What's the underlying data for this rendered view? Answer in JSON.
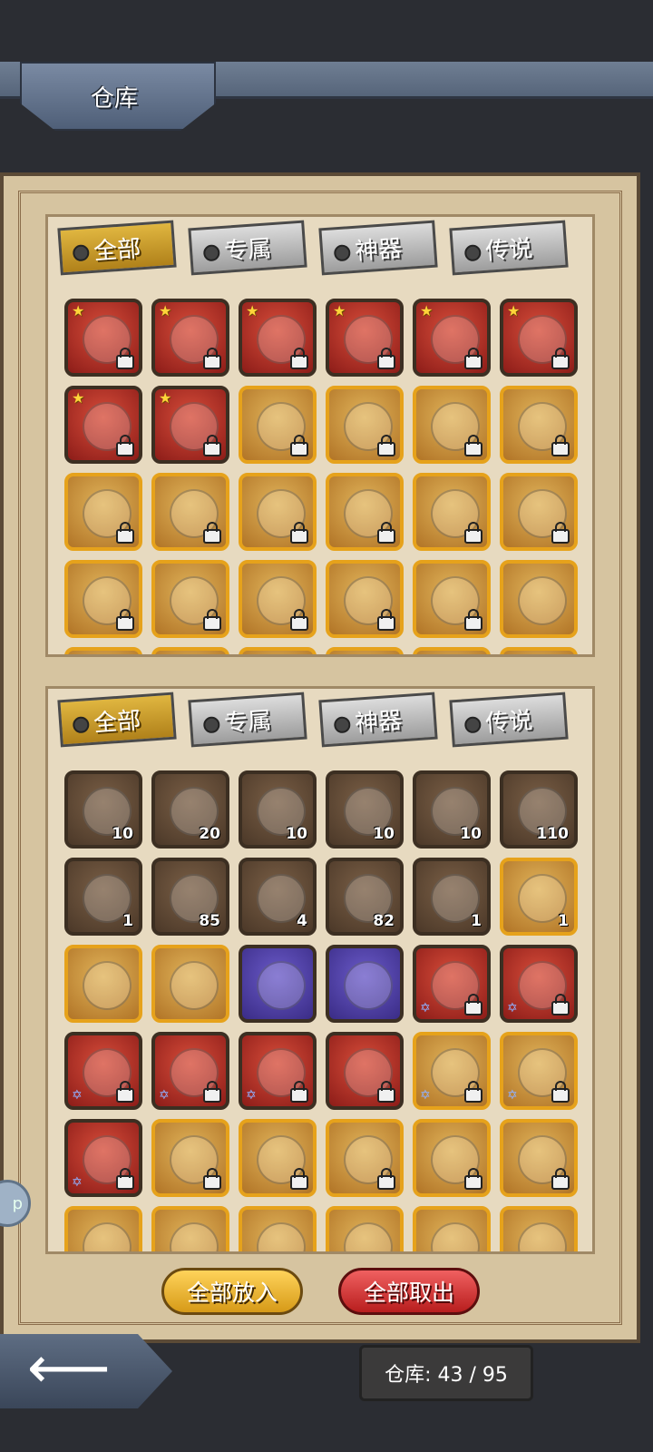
{
  "header": {
    "title": "仓库"
  },
  "top_section": {
    "tabs": [
      {
        "label": "全部",
        "active": true
      },
      {
        "label": "专属",
        "active": false
      },
      {
        "label": "神器",
        "active": false
      },
      {
        "label": "传说",
        "active": false
      }
    ],
    "items": [
      {
        "type": "red",
        "star": true,
        "lock": true
      },
      {
        "type": "red",
        "star": true,
        "lock": true
      },
      {
        "type": "red",
        "star": true,
        "lock": true
      },
      {
        "type": "red",
        "star": true,
        "lock": true
      },
      {
        "type": "red",
        "star": true,
        "lock": true
      },
      {
        "type": "red",
        "star": true,
        "lock": true
      },
      {
        "type": "red",
        "star": true,
        "lock": true
      },
      {
        "type": "red",
        "star": true,
        "lock": true
      },
      {
        "type": "gold",
        "star": false,
        "lock": true
      },
      {
        "type": "gold",
        "star": false,
        "lock": true
      },
      {
        "type": "gold",
        "star": false,
        "lock": true
      },
      {
        "type": "gold",
        "star": false,
        "lock": true
      },
      {
        "type": "gold",
        "star": false,
        "lock": true
      },
      {
        "type": "gold",
        "star": false,
        "lock": true
      },
      {
        "type": "gold",
        "star": false,
        "lock": true
      },
      {
        "type": "gold",
        "star": false,
        "lock": true
      },
      {
        "type": "gold",
        "star": false,
        "lock": true
      },
      {
        "type": "gold",
        "star": false,
        "lock": true
      },
      {
        "type": "gold",
        "star": false,
        "lock": true
      },
      {
        "type": "gold",
        "star": false,
        "lock": true
      },
      {
        "type": "gold",
        "star": false,
        "lock": true
      },
      {
        "type": "gold",
        "star": false,
        "lock": true
      },
      {
        "type": "gold",
        "star": false,
        "lock": true
      },
      {
        "type": "gold",
        "star": false,
        "lock": false
      },
      {
        "type": "gold",
        "star": false,
        "lock": false
      },
      {
        "type": "gold",
        "star": false,
        "lock": false
      },
      {
        "type": "gold",
        "star": false,
        "lock": false
      },
      {
        "type": "gold",
        "star": false,
        "lock": false
      },
      {
        "type": "gold",
        "star": false,
        "lock": false
      },
      {
        "type": "gold",
        "star": false,
        "lock": false
      }
    ]
  },
  "bottom_section": {
    "tabs": [
      {
        "label": "全部",
        "active": true
      },
      {
        "label": "专属",
        "active": false
      },
      {
        "label": "神器",
        "active": false
      },
      {
        "label": "传说",
        "active": false
      }
    ],
    "items": [
      {
        "type": "brown",
        "count": "10"
      },
      {
        "type": "brown",
        "count": "20"
      },
      {
        "type": "brown",
        "count": "10"
      },
      {
        "type": "brown",
        "count": "10"
      },
      {
        "type": "brown",
        "count": "10"
      },
      {
        "type": "brown",
        "count": "110"
      },
      {
        "type": "brown",
        "count": "1"
      },
      {
        "type": "brown",
        "count": "85"
      },
      {
        "type": "brown",
        "count": "4"
      },
      {
        "type": "brown",
        "count": "82"
      },
      {
        "type": "brown",
        "count": "1"
      },
      {
        "type": "gold",
        "count": "1"
      },
      {
        "type": "gold",
        "count": ""
      },
      {
        "type": "gold",
        "count": ""
      },
      {
        "type": "purple",
        "count": ""
      },
      {
        "type": "purple",
        "count": ""
      },
      {
        "type": "red",
        "count": "",
        "lock": true,
        "star6": true
      },
      {
        "type": "red",
        "count": "",
        "lock": true,
        "star6": true
      },
      {
        "type": "red",
        "count": "",
        "lock": true,
        "star6": true
      },
      {
        "type": "red",
        "count": "",
        "lock": true,
        "star6": true
      },
      {
        "type": "red",
        "count": "",
        "lock": true,
        "star6": true
      },
      {
        "type": "red",
        "count": "",
        "lock": true
      },
      {
        "type": "gold",
        "count": "",
        "lock": true,
        "star6": true
      },
      {
        "type": "gold",
        "count": "",
        "lock": true,
        "star6": true
      },
      {
        "type": "red",
        "count": "",
        "lock": true,
        "star6": true
      },
      {
        "type": "gold",
        "count": "",
        "lock": true
      },
      {
        "type": "gold",
        "count": "",
        "lock": true
      },
      {
        "type": "gold",
        "count": "",
        "lock": true
      },
      {
        "type": "gold",
        "count": "",
        "lock": true
      },
      {
        "type": "gold",
        "count": "",
        "lock": true
      },
      {
        "type": "gold",
        "count": ""
      },
      {
        "type": "gold",
        "count": ""
      },
      {
        "type": "gold",
        "count": ""
      },
      {
        "type": "gold",
        "count": ""
      },
      {
        "type": "gold",
        "count": ""
      },
      {
        "type": "gold",
        "count": ""
      }
    ]
  },
  "buttons": {
    "put_all": "全部放入",
    "take_all": "全部取出"
  },
  "capacity": "仓库: 43 / 95",
  "side_bubble": "p",
  "colors": {
    "panel": "#d6c4a0",
    "accent": "#e0b640"
  }
}
